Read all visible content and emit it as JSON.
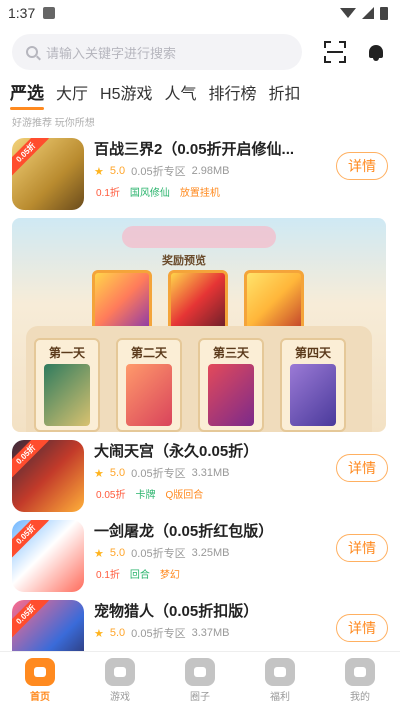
{
  "status_bar": {
    "time": "1:37"
  },
  "search": {
    "placeholder": "请输入关键字进行搜索"
  },
  "tabs": [
    {
      "label": "严选",
      "active": true
    },
    {
      "label": "大厅"
    },
    {
      "label": "H5游戏"
    },
    {
      "label": "人气"
    },
    {
      "label": "排行榜"
    },
    {
      "label": "折扣"
    }
  ],
  "subline": "好游推荐 玩你所想",
  "games": [
    {
      "name": "百战三界2（0.05折开启修仙...",
      "rating": "5.0",
      "zone": "0.05折专区",
      "size": "2.98MB",
      "tags": [
        "0.1折",
        "国风修仙",
        "放置挂机"
      ],
      "icon_tag": "0.05折",
      "button": "详情"
    },
    {
      "name": "大闹天宫（永久0.05折）",
      "rating": "5.0",
      "zone": "0.05折专区",
      "size": "3.31MB",
      "tags": [
        "0.05折",
        "卡牌",
        "Q版回合"
      ],
      "icon_tag": "0.05折",
      "button": "详情"
    },
    {
      "name": "一剑屠龙（0.05折红包版）",
      "rating": "5.0",
      "zone": "0.05折专区",
      "size": "3.25MB",
      "tags": [
        "0.1折",
        "回合",
        "梦幻"
      ],
      "icon_tag": "0.05折",
      "button": "详情"
    },
    {
      "name": "宠物猎人（0.05折扣版）",
      "rating": "5.0",
      "zone": "0.05折专区",
      "size": "3.37MB",
      "tags": [],
      "icon_tag": "0.05折",
      "button": "详情"
    }
  ],
  "banner": {
    "subtitle": "奖励预览",
    "days": [
      "第一天",
      "第二天",
      "第三天",
      "第四天"
    ]
  },
  "bottom_nav": [
    {
      "label": "首页",
      "active": true
    },
    {
      "label": "游戏"
    },
    {
      "label": "圈子"
    },
    {
      "label": "福利"
    },
    {
      "label": "我的"
    }
  ],
  "colors": {
    "accent": "#ff8a1f"
  }
}
